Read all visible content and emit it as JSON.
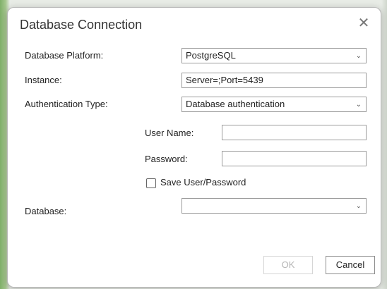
{
  "dialog": {
    "title": "Database Connection",
    "close_icon": "close-icon"
  },
  "form": {
    "platform_label": "Database Platform:",
    "platform_value": "PostgreSQL",
    "instance_label": "Instance:",
    "instance_value": "Server=;Port=5439",
    "auth_label": "Authentication Type:",
    "auth_value": "Database authentication",
    "username_label": "User Name:",
    "username_value": "",
    "password_label": "Password:",
    "password_value": "",
    "save_label": "Save User/Password",
    "database_label": "Database:",
    "database_value": ""
  },
  "buttons": {
    "ok": "OK",
    "cancel": "Cancel"
  },
  "colors": {
    "accent": "#7fb069"
  }
}
